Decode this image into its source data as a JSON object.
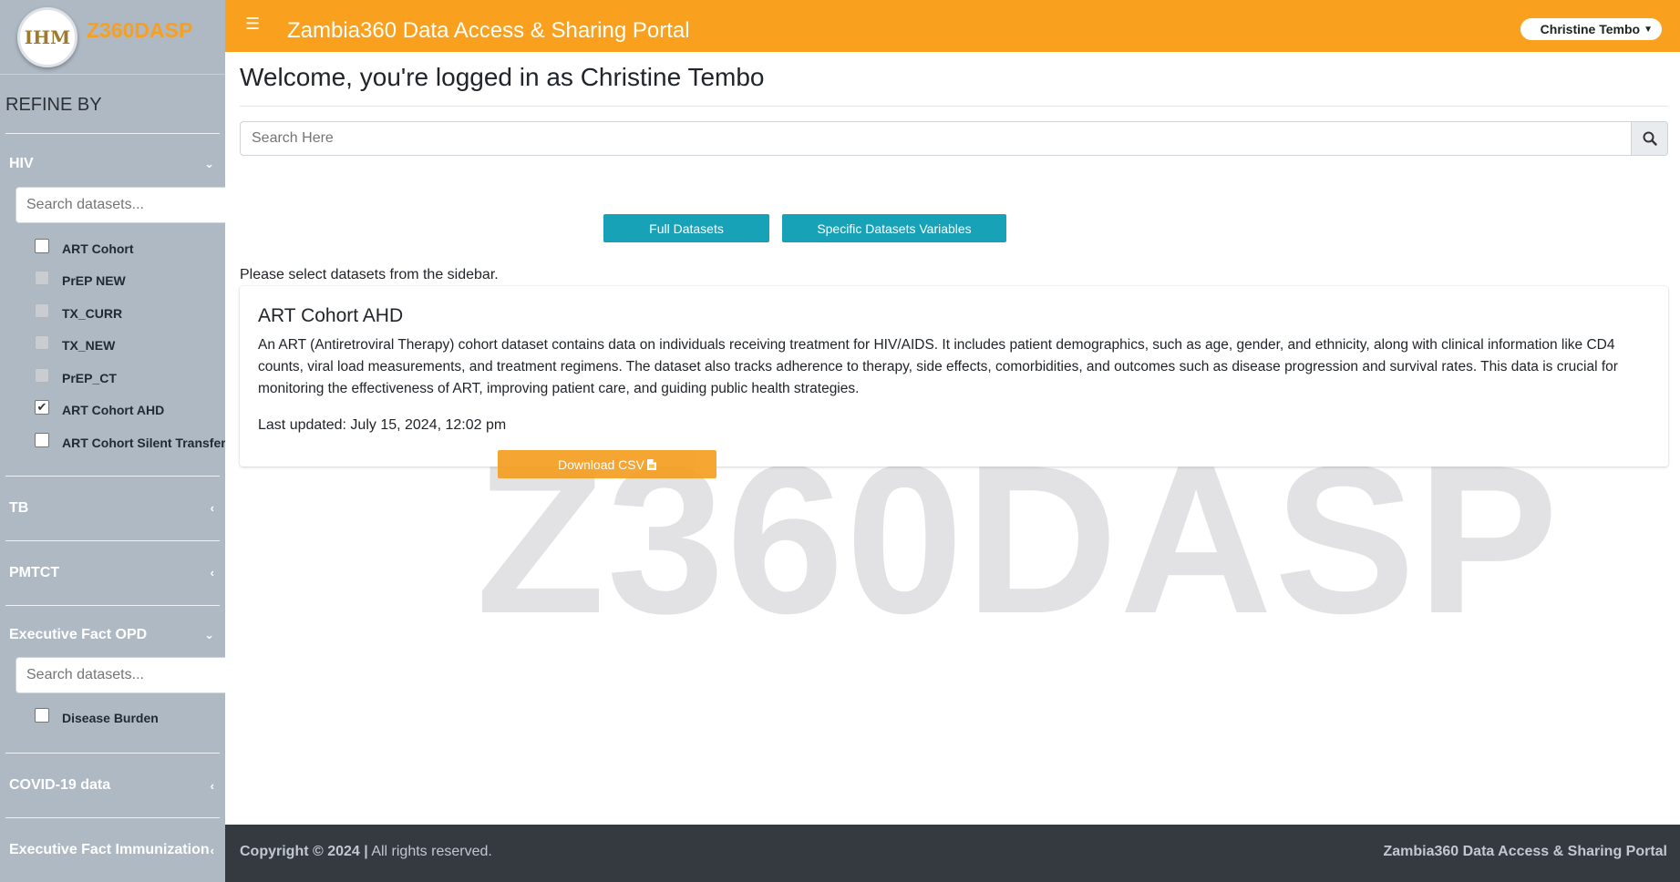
{
  "brand": {
    "logo_text": "IHM",
    "title": "Z360DASP"
  },
  "sidebar": {
    "refine_label": "REFINE BY",
    "groups": [
      {
        "name": "HIV",
        "expanded": true,
        "search_placeholder": "Search datasets...",
        "items": [
          {
            "label": "ART Cohort",
            "state": "unchecked"
          },
          {
            "label": "PrEP NEW",
            "state": "disabled"
          },
          {
            "label": "TX_CURR",
            "state": "disabled"
          },
          {
            "label": "TX_NEW",
            "state": "disabled"
          },
          {
            "label": "PrEP_CT",
            "state": "disabled"
          },
          {
            "label": "ART Cohort AHD",
            "state": "checked"
          },
          {
            "label": "ART Cohort Silent Transfers",
            "state": "unchecked"
          }
        ]
      },
      {
        "name": "TB",
        "expanded": false
      },
      {
        "name": "PMTCT",
        "expanded": false
      },
      {
        "name": "Executive Fact OPD",
        "expanded": true,
        "search_placeholder": "Search datasets...",
        "items": [
          {
            "label": "Disease Burden",
            "state": "unchecked"
          }
        ]
      },
      {
        "name": "COVID-19 data",
        "expanded": false
      },
      {
        "name": "Executive Fact Immunization",
        "expanded": false
      }
    ]
  },
  "header": {
    "portal_title": "Zambia360 Data Access & Sharing Portal",
    "user_name": "Christine Tembo"
  },
  "main": {
    "welcome": "Welcome, you're logged in as Christine Tembo",
    "search_placeholder": "Search Here",
    "full_datasets_label": "Full Datasets",
    "specific_variables_label": "Specific Datasets Variables",
    "hint": "Please select datasets from the sidebar.",
    "watermark": "Z360DASP",
    "card": {
      "title": "ART Cohort AHD",
      "description": "An ART (Antiretroviral Therapy) cohort dataset contains data on individuals receiving treatment for HIV/AIDS. It includes patient demographics, such as age, gender, and ethnicity, along with clinical information like CD4 counts, viral load measurements, and treatment regimens. The dataset also tracks adherence to therapy, side effects, comorbidities, and outcomes such as disease progression and survival rates. This data is crucial for monitoring the effectiveness of ART, improving patient care, and guiding public health strategies.",
      "last_updated": "Last updated: July 15, 2024, 12:02 pm",
      "download_label": "Download CSV"
    }
  },
  "footer": {
    "copyright": "Copyright © 2024 |",
    "rights": " All rights reserved.",
    "portal_name": "Zambia360 Data Access & Sharing Portal"
  },
  "colors": {
    "accent": "#f9a01e",
    "teal": "#17a2b8",
    "sidebar": "#aeb9c4",
    "footer": "#343a40"
  },
  "icons": [
    "hamburger-icon",
    "search-icon",
    "chevron-down-icon",
    "chevron-left-icon",
    "file-icon",
    "caret-down-icon"
  ]
}
